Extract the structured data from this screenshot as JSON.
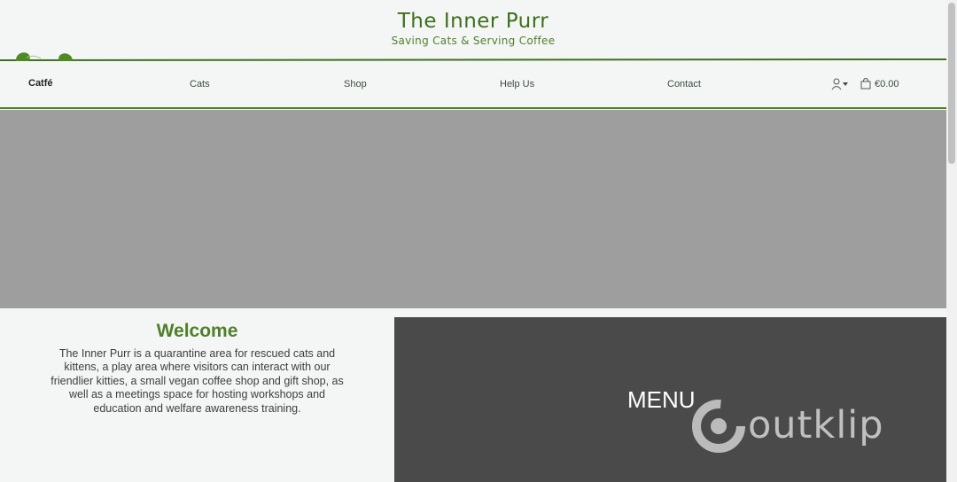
{
  "header": {
    "title": "The Inner Purr",
    "tagline": "Saving Cats & Serving Coffee"
  },
  "nav": {
    "brand": "Catfé",
    "items": [
      {
        "label": "Cats"
      },
      {
        "label": "Shop"
      },
      {
        "label": "Help Us"
      },
      {
        "label": "Contact"
      }
    ],
    "cart_total": "€0.00"
  },
  "welcome": {
    "title": "Welcome",
    "text": "The Inner Purr is a quarantine area for rescued cats and kittens, a play area where visitors can interact with our friendlier kitties, a small vegan coffee shop and gift shop, as well as a meetings space for hosting workshops and education and welfare awareness training."
  },
  "menu_panel": {
    "title": "MENU"
  },
  "watermark": {
    "text": "outklip"
  },
  "colors": {
    "accent_green": "#4f7f28",
    "hero_gray": "#9e9e9e",
    "menu_panel": "#4a4a4a",
    "background": "#f4f6f6"
  }
}
